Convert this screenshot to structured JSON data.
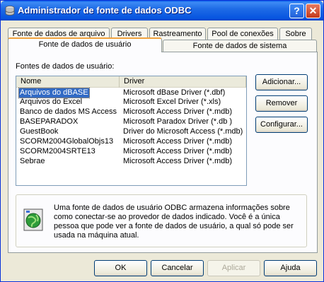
{
  "window": {
    "title": "Administrador de fonte de dados ODBC",
    "help_glyph": "?",
    "close_glyph": "✕"
  },
  "tabs_row1": [
    {
      "label": "Fonte de dados de arquivo"
    },
    {
      "label": "Drivers"
    },
    {
      "label": "Rastreamento"
    },
    {
      "label": "Pool de conexões"
    },
    {
      "label": "Sobre"
    }
  ],
  "tabs_row2": [
    {
      "label": "Fonte de dados de usuário",
      "active": true
    },
    {
      "label": "Fonte de dados de sistema",
      "active": false
    }
  ],
  "datasources": {
    "group_label": "Fontes de dados de usuário:",
    "columns": [
      "Nome",
      "Driver"
    ],
    "rows": [
      {
        "name": "Arquivos do dBASE",
        "driver": "Microsoft dBase Driver (*.dbf)",
        "selected": true
      },
      {
        "name": "Arquivos do Excel",
        "driver": "Microsoft Excel Driver (*.xls)"
      },
      {
        "name": "Banco de dados MS Access",
        "driver": "Microsoft Access Driver (*.mdb)"
      },
      {
        "name": "BASEPARADOX",
        "driver": "Microsoft Paradox Driver (*.db )"
      },
      {
        "name": "GuestBook",
        "driver": "Driver do Microsoft Access (*.mdb)"
      },
      {
        "name": "SCORM2004GlobalObjs13",
        "driver": "Microsoft Access Driver (*.mdb)"
      },
      {
        "name": "SCORM2004SRTE13",
        "driver": "Microsoft Access Driver (*.mdb)"
      },
      {
        "name": "Sebrae",
        "driver": "Microsoft Access Driver (*.mdb)"
      }
    ]
  },
  "side_buttons": {
    "add": "Adicionar...",
    "remove": "Remover",
    "configure": "Configurar..."
  },
  "info": {
    "text": "Uma fonte de dados de usuário ODBC armazena informações sobre como conectar-se ao provedor de dados indicado. Você é a única pessoa que pode ver a fonte de dados de usuário, a qual só pode ser usada na máquina atual."
  },
  "footer_buttons": {
    "ok": "OK",
    "cancel": "Cancelar",
    "apply": "Aplicar",
    "help": "Ajuda"
  },
  "colors": {
    "titlebar": "#0755e0",
    "selection": "#316ac5",
    "active_tab_accent": "#f1a33e"
  }
}
